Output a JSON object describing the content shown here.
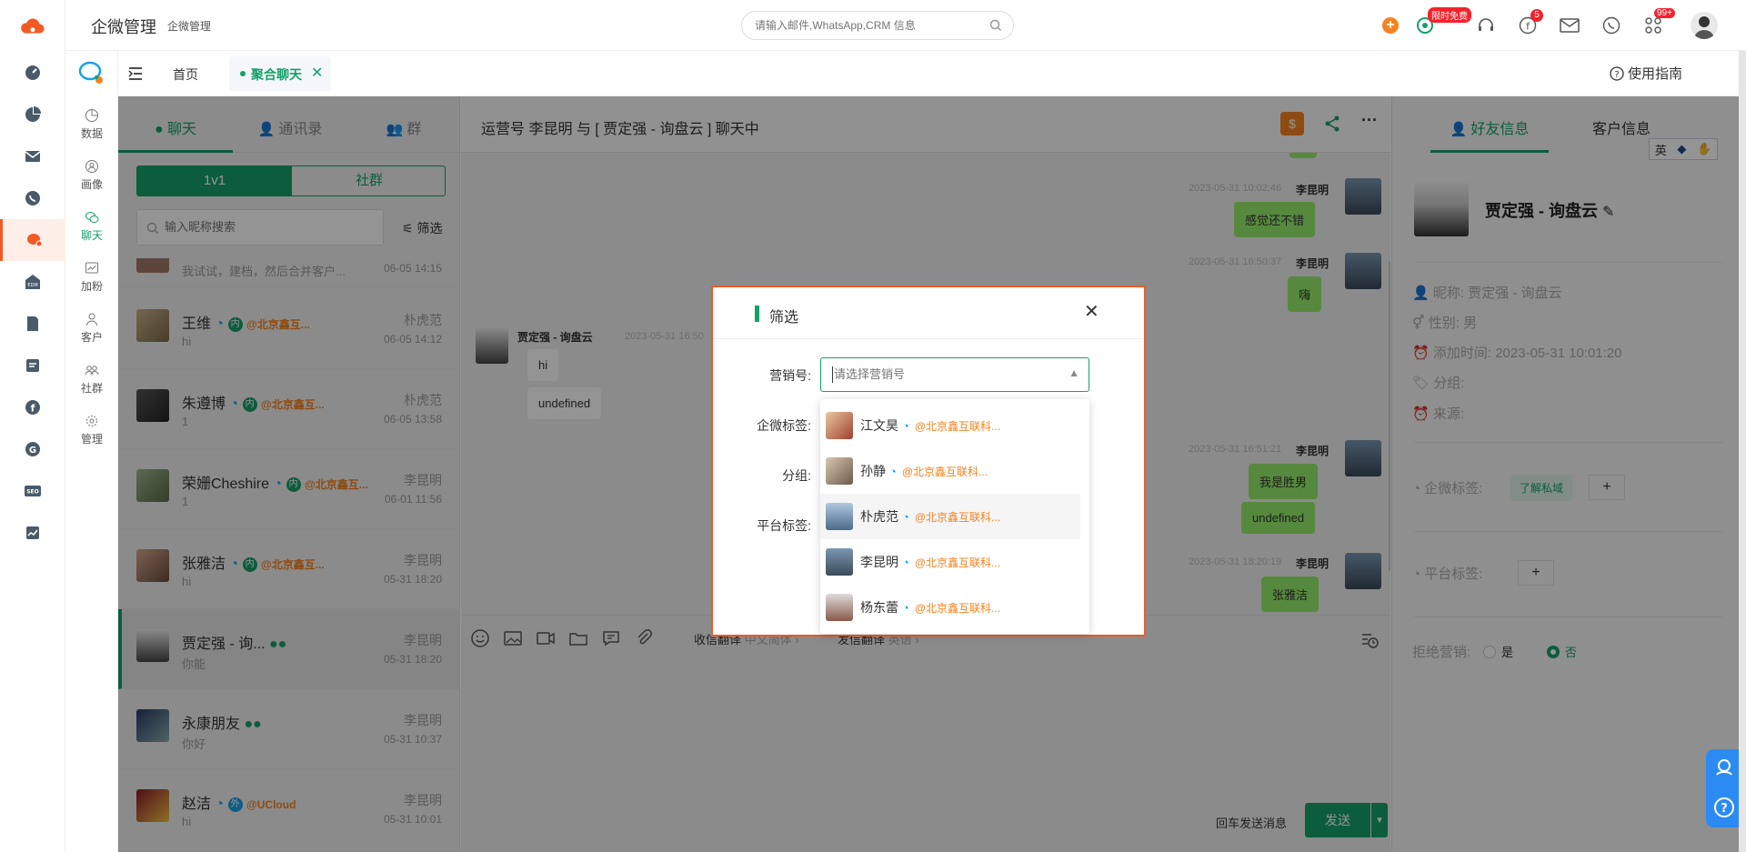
{
  "topbar": {
    "app_title": "企微管理",
    "app_subtitle": "企微管理",
    "search_placeholder": "请输入邮件,WhatsApp,CRM 信息",
    "free_badge": "限时免费",
    "fb_badge": "5",
    "apps_badge": "99+"
  },
  "subnav": {
    "items": [
      {
        "label": "数据"
      },
      {
        "label": "画像"
      },
      {
        "label": "聊天"
      },
      {
        "label": "加粉"
      },
      {
        "label": "客户"
      },
      {
        "label": "社群"
      },
      {
        "label": "管理"
      }
    ]
  },
  "tabs": {
    "home": "首页",
    "active": "聚合聊天",
    "guide": "使用指南"
  },
  "left": {
    "tabs": [
      "聊天",
      "通讯录",
      "群"
    ],
    "segment": [
      "1v1",
      "社群"
    ],
    "search_placeholder": "输入昵称搜索",
    "filter_label": "筛选",
    "partial_item": {
      "msg": "我试试，建档，然后合并客户...",
      "time": "06-05 14:15"
    },
    "items": [
      {
        "name": "王维",
        "tag": "内",
        "org": "@北京鑫互...",
        "msg": "hi",
        "agent": "朴虎范",
        "time": "06-05 14:12"
      },
      {
        "name": "朱遵博",
        "tag": "内",
        "org": "@北京鑫互...",
        "msg": "1",
        "agent": "朴虎范",
        "time": "06-05 13:58"
      },
      {
        "name": "荣姗Cheshire",
        "tag": "内",
        "org": "@北京鑫互...",
        "msg": "1",
        "agent": "李昆明",
        "time": "06-01 11:56"
      },
      {
        "name": "张雅洁",
        "tag": "内",
        "org": "@北京鑫互...",
        "msg": "hi",
        "agent": "李昆明",
        "time": "05-31 18:20"
      },
      {
        "name": "贾定强 - 询...",
        "tag": "",
        "org": "",
        "msg": "你能",
        "agent": "李昆明",
        "time": "05-31 18:20"
      },
      {
        "name": "永康朋友",
        "tag": "",
        "org": "",
        "msg": "你好",
        "agent": "李昆明",
        "time": "05-31 10:37"
      },
      {
        "name": "赵洁",
        "tag": "外",
        "org": "@UCloud",
        "msg": "hi",
        "agent": "李昆明",
        "time": "05-31 10:01"
      }
    ]
  },
  "chat": {
    "header": "运营号 李昆明 与 [ 贾定强 - 询盘云 ] 聊天中",
    "messages": [
      {
        "time": "2023-05-31 10:02:46",
        "sender": "李昆明",
        "text": "感觉还不错"
      },
      {
        "time": "2023-05-31 16:50:37",
        "sender": "李昆明",
        "text": "嗨"
      },
      {
        "time": "2023-05-31 16:50",
        "sender": "贾定强 - 询盘云",
        "text": "hi",
        "text2": "undefined"
      },
      {
        "time": "2023-05-31 16:51:21",
        "sender": "李昆明",
        "text": "我是胜男",
        "text2": "undefined"
      },
      {
        "time": "2023-05-31 18:20:19",
        "sender": "李昆明",
        "text": "张雅洁"
      }
    ],
    "toolbar": {
      "recv_translate": "收信翻译",
      "recv_lang": "中文简体",
      "send_translate": "发信翻译",
      "send_lang": "英语"
    },
    "enter_hint": "回车发送消息",
    "send": "发送"
  },
  "right": {
    "tabs": [
      "好友信息",
      "客户信息"
    ],
    "ime": "英",
    "name": "贾定强 - 询盘云",
    "fields": [
      {
        "label": "昵称:",
        "value": "贾定强 - 询盘云"
      },
      {
        "label": "性别:",
        "value": "男"
      },
      {
        "label": "添加时间:",
        "value": "2023-05-31 10:01:20"
      },
      {
        "label": "分组:",
        "value": ""
      },
      {
        "label": "来源:",
        "value": ""
      }
    ],
    "corp_tag_label": "企微标签:",
    "corp_tag": "了解私域",
    "platform_tag_label": "平台标签:",
    "reject_label": "拒绝营销:",
    "reject_yes": "是",
    "reject_no": "否"
  },
  "modal": {
    "title": "筛选",
    "labels": {
      "account": "营销号:",
      "corp_tag": "企微标签:",
      "group": "分组:",
      "platform_tag": "平台标签:"
    },
    "account_placeholder": "请选择营销号",
    "options": [
      {
        "name": "江文昊",
        "org": "@北京鑫互联科..."
      },
      {
        "name": "孙静",
        "org": "@北京鑫互联科..."
      },
      {
        "name": "朴虎范",
        "org": "@北京鑫互联科..."
      },
      {
        "name": "李昆明",
        "org": "@北京鑫互联科..."
      },
      {
        "name": "杨东蕾",
        "org": "@北京鑫互联科..."
      }
    ]
  },
  "colors": {
    "brand": "#f15a24",
    "green": "#16a06a",
    "org": "#f58220",
    "bubble": "#95ec69"
  }
}
